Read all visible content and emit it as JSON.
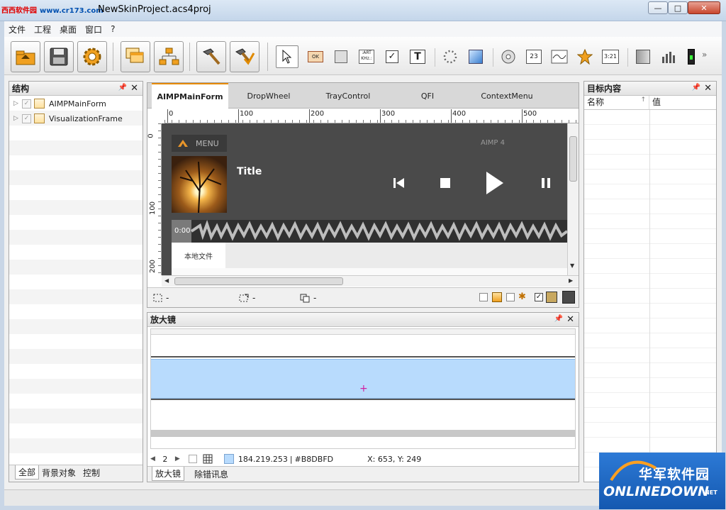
{
  "watermark_top": {
    "site": "西西软件园",
    "url": "www.cr173.com"
  },
  "window": {
    "title": "NewSkinProject.acs4proj",
    "min": "—",
    "max": "□",
    "close": "✕"
  },
  "menubar": {
    "items": [
      "文件",
      "工程",
      "桌面",
      "窗口",
      "?"
    ]
  },
  "toolbar": {
    "big_buttons": [
      "open-icon",
      "save-icon",
      "settings-gear-icon",
      "windows-stack-icon",
      "hierarchy-icon",
      "build-hammer-icon",
      "build-check-icon"
    ],
    "small_tools": [
      "pointer-icon",
      "button-ok-icon",
      "panel-icon",
      "art-khz-icon",
      "checkbox-icon",
      "text-icon",
      "dots-circle-icon",
      "image-icon",
      "cd-icon",
      "number-23-icon",
      "wave-icon",
      "star-icon",
      "timer-icon",
      "spectrum-icon",
      "equalizer-icon",
      "led-icon",
      "more-chevron-icon"
    ],
    "labels": {
      "ok": "OK",
      "art": ":ART KHz.:",
      "num23": "23",
      "num321": "3:21",
      "text": "T"
    }
  },
  "structure_panel": {
    "title": "结构",
    "nodes": [
      {
        "label": "AIMPMainForm"
      },
      {
        "label": "VisualizationFrame"
      }
    ],
    "bottom_tabs": [
      "全部",
      "背景对象",
      "控制"
    ]
  },
  "designer": {
    "tabs": [
      "AIMPMainForm",
      "DropWheel",
      "TrayControl",
      "QFI",
      "ContextMenu"
    ],
    "ruler_h": [
      "0",
      "100",
      "200",
      "300",
      "400",
      "500"
    ],
    "ruler_v": [
      "0",
      "100",
      "200"
    ],
    "status_items": [
      "-",
      "-",
      "-"
    ]
  },
  "aimp_preview": {
    "menu_label": "MENU",
    "version": "AIMP 4",
    "track_title": "Title",
    "time": "0:00",
    "tab_label": "本地文件"
  },
  "magnifier_panel": {
    "title": "放大镜",
    "zoom_value": "2",
    "color_rgb": "184.219.253",
    "color_hex": "#B8DBFD",
    "coords": "X: 653, Y: 249",
    "bottom_tabs": [
      "放大镜",
      "除错讯息"
    ]
  },
  "target_panel": {
    "title": "目标内容",
    "col_name": "名称",
    "col_value": "值",
    "sort_indicator": "↑"
  },
  "watermark_bottom": {
    "cn": "华军软件园",
    "en": "ONLINEDOWN",
    "suffix": ".NET"
  },
  "colors": {
    "accent_tab": "#e68a00",
    "magnifier_fill": "#B8DBFD",
    "aimp_bg": "#4a4a4a"
  }
}
